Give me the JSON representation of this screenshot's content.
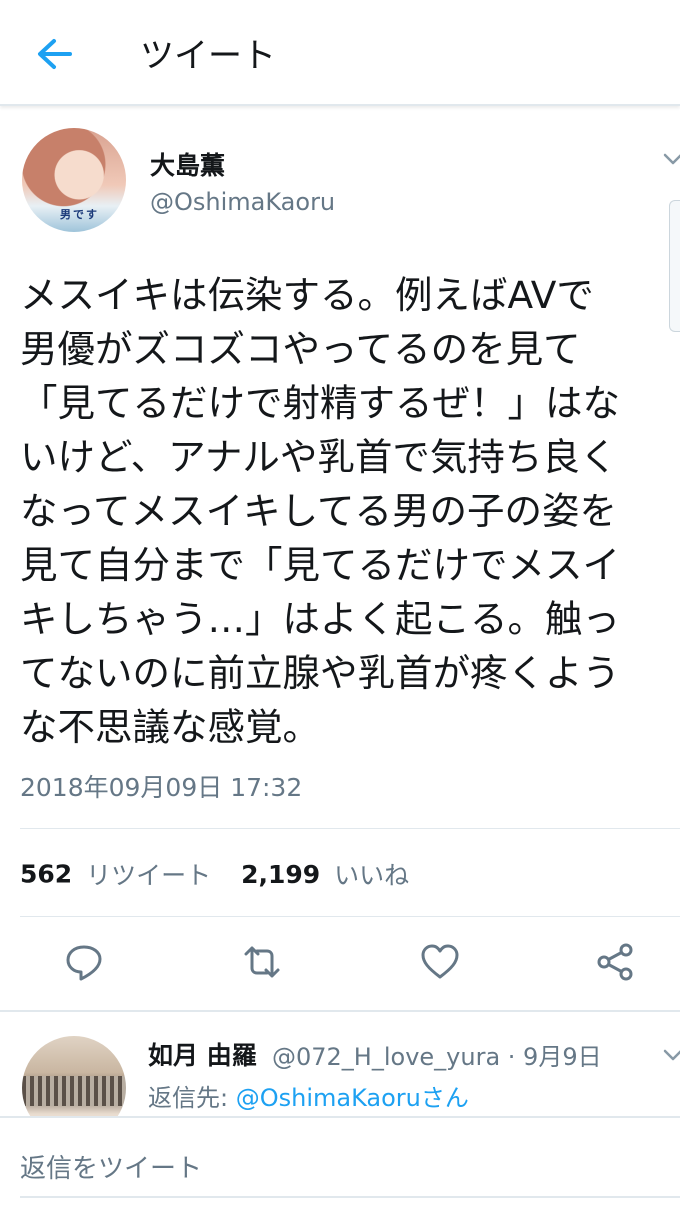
{
  "header": {
    "back_icon": "arrow-left-icon",
    "title": "ツイート",
    "accent_color": "#1da1f2"
  },
  "tweet": {
    "author_name": "大島薫",
    "author_handle": "@OshimaKaoru",
    "avatar_text": "男です",
    "text": "メスイキは伝染する。例えばAVで\n男優がズコズコやってるのを見て\n「見てるだけで射精するぜ！」はな\nいけど、アナルや乳首で気持ち良く\nなってメスイキしてる男の子の姿を\n見て自分まで「見てるだけでメスイ\nキしちゃう…」はよく起こる。触っ\nてないのに前立腺や乳首が疼くよう\nな不思議な感覚。",
    "timestamp": "2018年09月09日 17:32",
    "retweet_count": "562",
    "retweet_label": "リツイート",
    "like_count": "2,199",
    "like_label": "いいね"
  },
  "actions": [
    "reply-icon",
    "retweet-icon",
    "like-icon",
    "share-icon"
  ],
  "reply": {
    "author_name": "如月 由羅",
    "meta": "@072_H_love_yura · 9月9日",
    "reply_to_label": "返信先: ",
    "reply_to_handle": "@OshimaKaoruさん"
  },
  "compose": {
    "placeholder": "返信をツイート"
  },
  "colors": {
    "text": "#14171a",
    "secondary": "#657786",
    "link": "#1da1f2",
    "divider": "#e1e8ed"
  }
}
